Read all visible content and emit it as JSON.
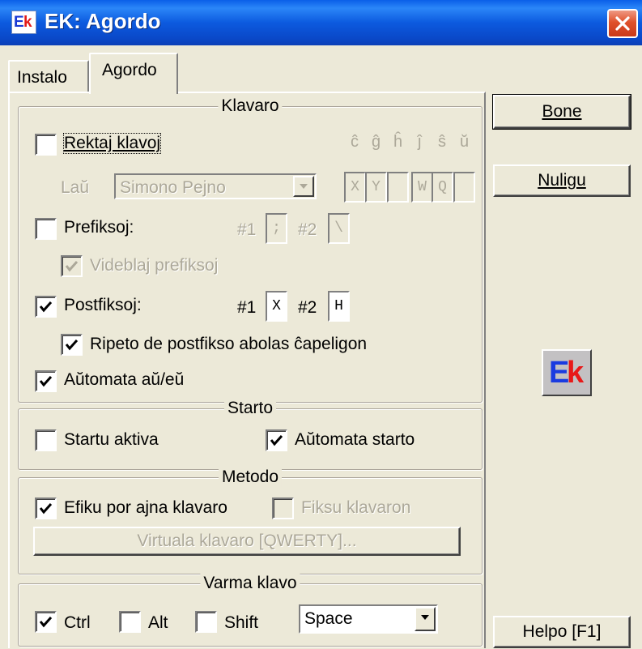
{
  "window": {
    "title": "EK: Agordo"
  },
  "tabs": [
    {
      "label": "Instalo",
      "active": false
    },
    {
      "label": "Agordo",
      "active": true
    }
  ],
  "klavaro": {
    "legend": "Klavaro",
    "rektaj": {
      "label": "Rektaj klavoj",
      "checked": false
    },
    "hats": [
      "ĉ",
      "ĝ",
      "ĥ",
      "ĵ",
      "ŝ",
      "ŭ"
    ],
    "hat_keys": [
      "X",
      "Y",
      "",
      "W",
      "Q",
      ""
    ],
    "lau_label": "Laŭ",
    "layout_value": "Simono Pejno",
    "prefiksoj": {
      "label": "Prefiksoj:",
      "checked": false,
      "n1": "#1",
      "v1": ";",
      "n2": "#2",
      "v2": "\\"
    },
    "videblaj": {
      "label": "Videblaj prefiksoj",
      "checked": true
    },
    "postfiksoj": {
      "label": "Postfiksoj:",
      "checked": true,
      "n1": "#1",
      "v1": "X",
      "n2": "#2",
      "v2": "H"
    },
    "ripeto": {
      "label": "Ripeto de postfikso abolas ĉapeligon",
      "checked": true
    },
    "automata_au": {
      "label": "Aŭtomata aŭ/eŭ",
      "checked": true
    }
  },
  "starto": {
    "legend": "Starto",
    "startu": {
      "label": "Startu aktiva",
      "checked": false
    },
    "automata_starto": {
      "label": "Aŭtomata starto",
      "checked": true
    }
  },
  "metodo": {
    "legend": "Metodo",
    "efiku": {
      "label": "Efiku por ajna klavaro",
      "checked": true
    },
    "fiksu": {
      "label": "Fiksu klavaron",
      "checked": false
    },
    "virtuala_button": "Virtuala klavaro [QWERTY]..."
  },
  "varma": {
    "legend": "Varma klavo",
    "ctrl": {
      "label": "Ctrl",
      "checked": true
    },
    "alt": {
      "label": "Alt",
      "checked": false
    },
    "shift": {
      "label": "Shift",
      "checked": false
    },
    "key_value": "Space"
  },
  "buttons": {
    "bone": "Bone",
    "nuligu": "Nuligu",
    "helpo": "Helpo [F1]"
  },
  "logo": {
    "e": "E",
    "k": "k"
  },
  "colors": {
    "titlebar": "#0a5fe8",
    "close": "#e0512b",
    "face": "#ece9d8",
    "disabled_text": "#aca899"
  }
}
